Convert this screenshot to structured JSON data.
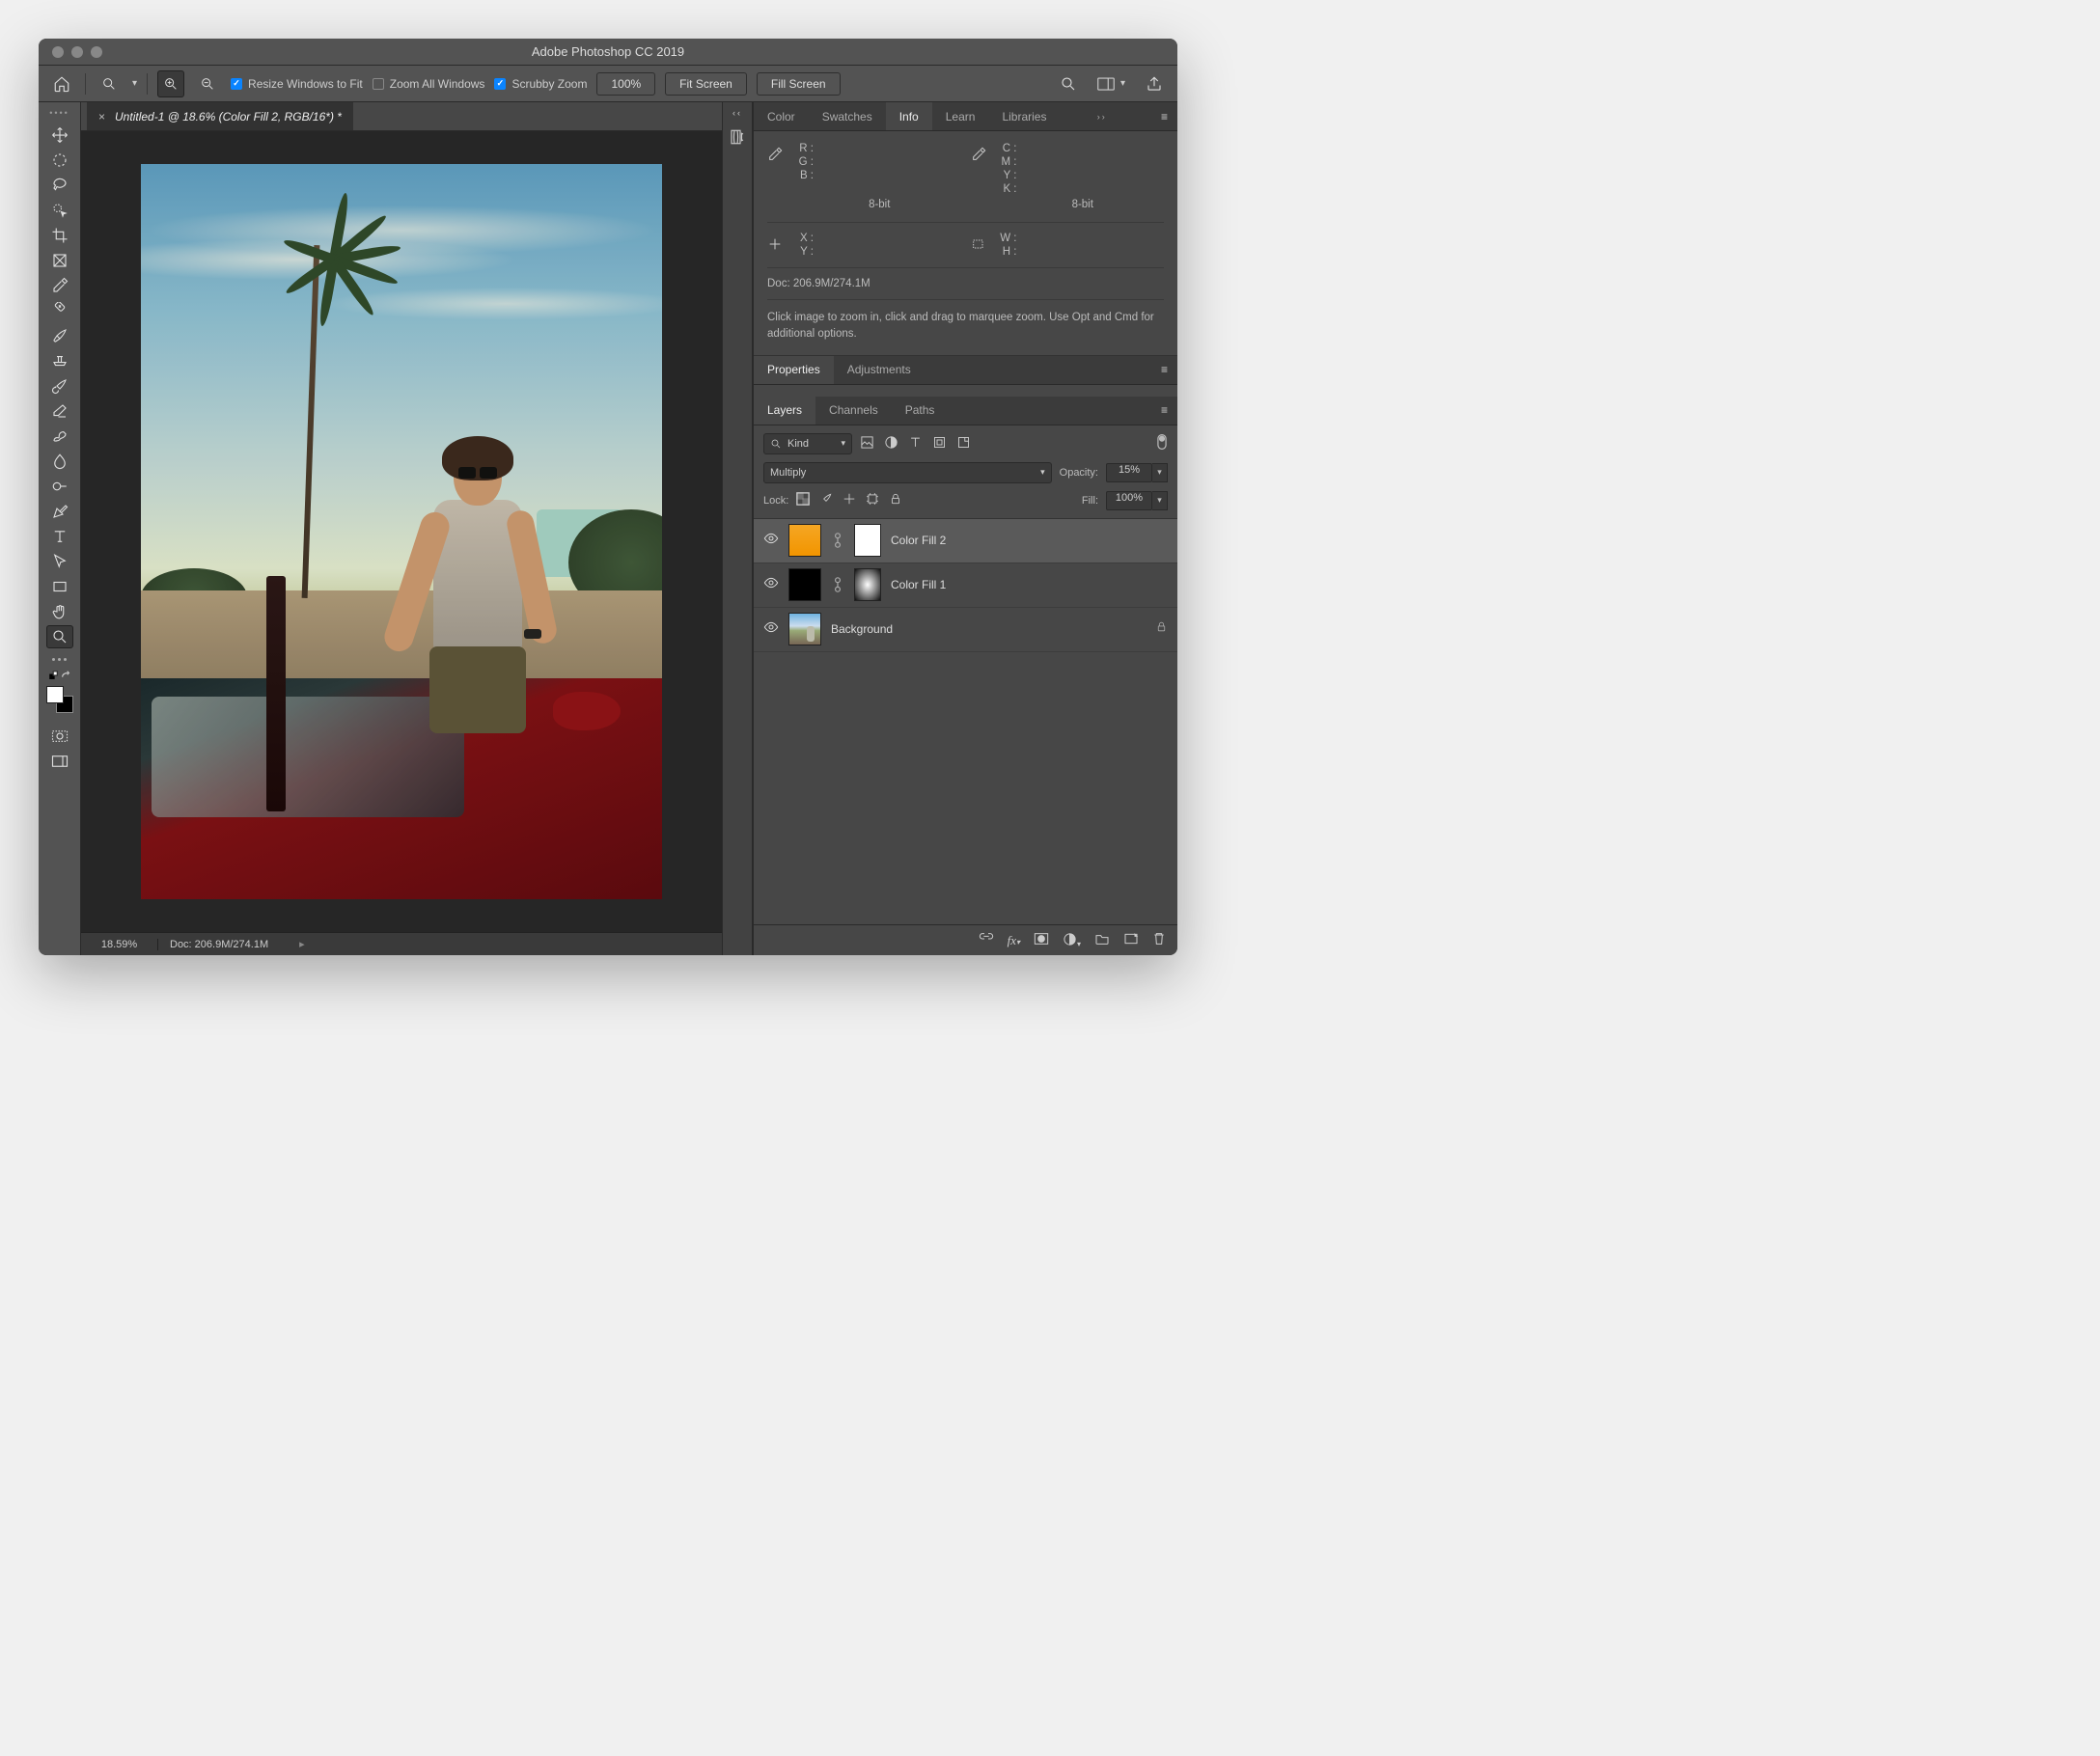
{
  "app_title": "Adobe Photoshop CC 2019",
  "options_bar": {
    "resize_windows_label": "Resize Windows to Fit",
    "resize_windows_checked": true,
    "zoom_all_label": "Zoom All Windows",
    "zoom_all_checked": false,
    "scrubby_label": "Scrubby Zoom",
    "scrubby_checked": true,
    "zoom_value": "100%",
    "fit_screen": "Fit Screen",
    "fill_screen": "Fill Screen"
  },
  "document": {
    "tab_title": "Untitled-1 @ 18.6% (Color Fill 2, RGB/16*) *",
    "status_zoom": "18.59%",
    "status_info": "Doc: 206.9M/274.1M"
  },
  "panels": {
    "info_tabs": [
      "Color",
      "Swatches",
      "Info",
      "Learn",
      "Libraries"
    ],
    "info_active": "Info",
    "info": {
      "rgb": {
        "R": "R :",
        "G": "G :",
        "B": "B :"
      },
      "cmyk": {
        "C": "C :",
        "M": "M :",
        "Y": "Y :",
        "K": "K :"
      },
      "bit1": "8-bit",
      "bit2": "8-bit",
      "xy": {
        "X": "X :",
        "Y": "Y :"
      },
      "wh": {
        "W": "W :",
        "H": "H :"
      },
      "doc": "Doc: 206.9M/274.1M",
      "hint": "Click image to zoom in, click and drag to marquee zoom.  Use Opt and Cmd for additional options."
    },
    "props_tabs": [
      "Properties",
      "Adjustments"
    ],
    "props_active": "Properties",
    "layer_tabs": [
      "Layers",
      "Channels",
      "Paths"
    ],
    "layer_active": "Layers",
    "layers_panel": {
      "filter_label": "Kind",
      "blend_mode": "Multiply",
      "opacity_label": "Opacity:",
      "opacity_value": "15%",
      "lock_label": "Lock:",
      "fill_label": "Fill:",
      "fill_value": "100%",
      "layers": [
        {
          "name": "Color Fill 2",
          "selected": true,
          "type": "fill-orange",
          "mask": "white"
        },
        {
          "name": "Color Fill 1",
          "selected": false,
          "type": "fill-black",
          "mask": "grad"
        },
        {
          "name": "Background",
          "selected": false,
          "type": "bg",
          "locked": true
        }
      ]
    }
  }
}
